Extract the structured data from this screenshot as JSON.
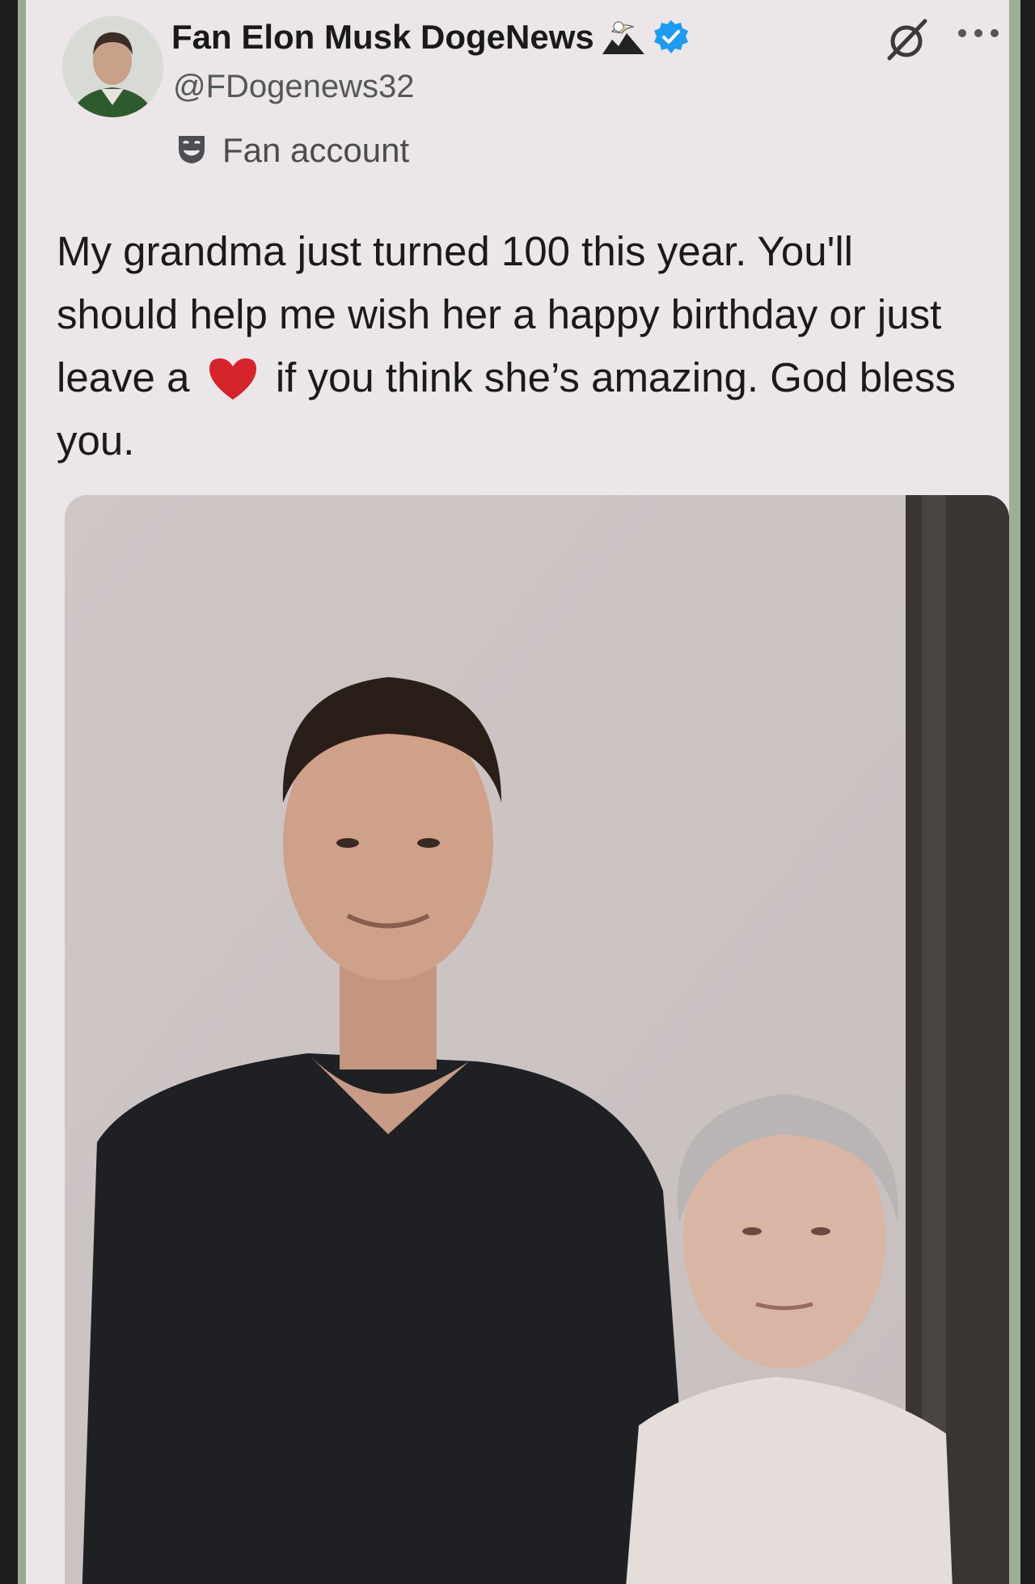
{
  "tweet": {
    "display_name": "Fan Elon Musk DogeNews",
    "handle": "@FDogenews32",
    "account_label": "Fan account",
    "text_part1": "My grandma just turned 100 this year. You'll should help me wish her a happy birthday or just leave a",
    "text_part2": "if you think she’s amazing. God bless you.",
    "icons": [
      "eagle-icon",
      "verified-icon",
      "grok-icon",
      "more-icon",
      "theater-mask-icon",
      "heart-icon"
    ],
    "colors": {
      "verified_blue": "#1d9bf0",
      "heart_red": "#d5232b",
      "background": "#ece6e8"
    }
  }
}
